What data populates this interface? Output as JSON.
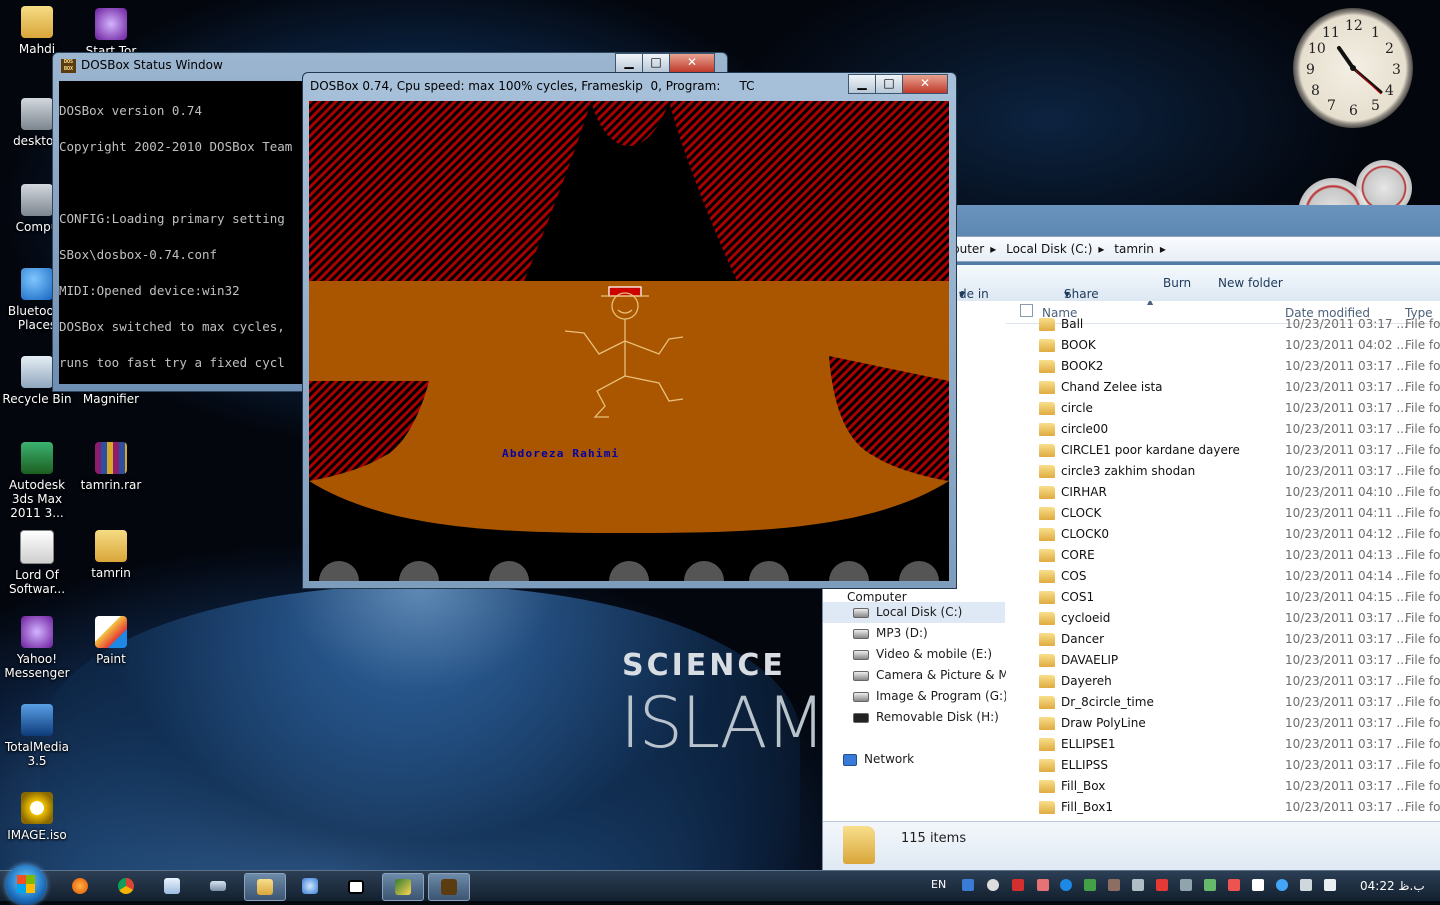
{
  "desktop": {
    "icons": [
      {
        "label": "Mahdi",
        "icon": "folder-icon"
      },
      {
        "label": "Start Tor",
        "icon": "tor-icon"
      },
      {
        "label": "desktop",
        "icon": "computer-icon"
      },
      {
        "label": "Compu",
        "icon": "computer-icon"
      },
      {
        "label": "Bluetooth Places",
        "icon": "bluetooth-icon"
      },
      {
        "label": "Recycle Bin",
        "icon": "recycle-bin-icon"
      },
      {
        "label": "Magnifier",
        "icon": "magnifier-icon"
      },
      {
        "label": "Autodesk 3ds Max 2011 3...",
        "icon": "3ds-max-icon"
      },
      {
        "label": "tamrin.rar",
        "icon": "rar-icon"
      },
      {
        "label": "Lord Of Softwar...",
        "icon": "cd-icon"
      },
      {
        "label": "tamrin",
        "icon": "folder-icon"
      },
      {
        "label": "Yahoo! Messenger",
        "icon": "yahoo-icon"
      },
      {
        "label": "Paint",
        "icon": "paint-icon"
      },
      {
        "label": "TotalMedia 3.5",
        "icon": "media-icon"
      },
      {
        "label": "IMAGE.iso",
        "icon": "iso-icon"
      }
    ],
    "wallpaper": {
      "line1": "SCIENCE",
      "line2": "ISLAM"
    }
  },
  "clock_gadget": {
    "numbers": [
      "12",
      "1",
      "2",
      "3",
      "4",
      "5",
      "6",
      "7",
      "8",
      "9",
      "10",
      "11"
    ]
  },
  "status_window": {
    "title": "DOSBox Status Window",
    "lines": [
      "DOSBox version 0.74",
      "Copyright 2002-2010 DOSBox Team",
      "",
      "CONFIG:Loading primary setting",
      "SBox\\dosbox-0.74.conf",
      "MIDI:Opened device:win32",
      "DOSBox switched to max cycles,",
      "runs too fast try a fixed cycl"
    ]
  },
  "dosbox": {
    "title": "DOSBox 0.74, Cpu speed: max 100% cycles, Frameskip  0, Program:     TC",
    "stage_text": "Abdoreza Rahimi",
    "colors": {
      "curtain": "#aa0000",
      "floor": "#aa5500",
      "figure": "#e8c07a",
      "hat": "#cc0000",
      "name": "#0000aa"
    }
  },
  "explorer": {
    "breadcrumb": [
      "puter",
      "Local Disk (C:)",
      "tamrin"
    ],
    "commands": {
      "library": "de in library",
      "share": "Share with",
      "burn": "Burn",
      "new_folder": "New folder"
    },
    "columns": {
      "name": "Name",
      "date": "Date modified",
      "type": "Type"
    },
    "nav": [
      {
        "label": "Computer",
        "icon": "computer-icon"
      },
      {
        "label": "Local Disk (C:)",
        "icon": "drive-icon"
      },
      {
        "label": "MP3 (D:)",
        "icon": "drive-icon"
      },
      {
        "label": "Video & mobile (E:)",
        "icon": "drive-icon"
      },
      {
        "label": "Camera & Picture & Mah",
        "icon": "drive-icon"
      },
      {
        "label": "Image & Program (G:)",
        "icon": "drive-icon"
      },
      {
        "label": "Removable Disk (H:)",
        "icon": "usb-drive-icon"
      },
      {
        "label": "Network",
        "icon": "network-icon"
      }
    ],
    "files": [
      {
        "name": "Ball",
        "date": "10/23/2011 03:17 ...",
        "type": "File fol"
      },
      {
        "name": "BOOK",
        "date": "10/23/2011 04:02 ...",
        "type": "File fol"
      },
      {
        "name": "BOOK2",
        "date": "10/23/2011 03:17 ...",
        "type": "File fol"
      },
      {
        "name": "Chand Zelee ista",
        "date": "10/23/2011 03:17 ...",
        "type": "File fol"
      },
      {
        "name": "circle",
        "date": "10/23/2011 03:17 ...",
        "type": "File fol"
      },
      {
        "name": "circle00",
        "date": "10/23/2011 03:17 ...",
        "type": "File fol"
      },
      {
        "name": "CIRCLE1  poor kardane dayere",
        "date": "10/23/2011 03:17 ...",
        "type": "File fol"
      },
      {
        "name": "circle3 zakhim shodan",
        "date": "10/23/2011 03:17 ...",
        "type": "File fol"
      },
      {
        "name": "CIRHAR",
        "date": "10/23/2011 04:10 ...",
        "type": "File fol"
      },
      {
        "name": "CLOCK",
        "date": "10/23/2011 04:11 ...",
        "type": "File fol"
      },
      {
        "name": "CLOCK0",
        "date": "10/23/2011 04:12 ...",
        "type": "File fol"
      },
      {
        "name": "CORE",
        "date": "10/23/2011 04:13 ...",
        "type": "File fol"
      },
      {
        "name": "COS",
        "date": "10/23/2011 04:14 ...",
        "type": "File fol"
      },
      {
        "name": "COS1",
        "date": "10/23/2011 04:15 ...",
        "type": "File fol"
      },
      {
        "name": "cycloeid",
        "date": "10/23/2011 03:17 ...",
        "type": "File fol"
      },
      {
        "name": "Dancer",
        "date": "10/23/2011 03:17 ...",
        "type": "File fol"
      },
      {
        "name": "DAVAELIP",
        "date": "10/23/2011 03:17 ...",
        "type": "File fol"
      },
      {
        "name": "Dayereh",
        "date": "10/23/2011 03:17 ...",
        "type": "File fol"
      },
      {
        "name": "Dr_8circle_time",
        "date": "10/23/2011 03:17 ...",
        "type": "File fol"
      },
      {
        "name": "Draw PolyLine",
        "date": "10/23/2011 03:17 ...",
        "type": "File fol"
      },
      {
        "name": "ELLIPSE1",
        "date": "10/23/2011 03:17 ...",
        "type": "File fol"
      },
      {
        "name": "ELLIPSS",
        "date": "10/23/2011 03:17 ...",
        "type": "File fol"
      },
      {
        "name": "Fill_Box",
        "date": "10/23/2011 03:17 ...",
        "type": "File fol"
      },
      {
        "name": "Fill_Box1",
        "date": "10/23/2011 03:17 ...",
        "type": "File fol"
      }
    ],
    "status": "115 items"
  },
  "taskbar": {
    "buttons": [
      "firefox-icon",
      "chrome-icon",
      "notepad-icon",
      "keyboard-icon",
      "explorer-icon",
      "magnifier-icon",
      "window-icon",
      "dreamweaver-icon",
      "dosbox-icon"
    ],
    "lang": "EN",
    "time": "04:22 ب.ظ"
  }
}
